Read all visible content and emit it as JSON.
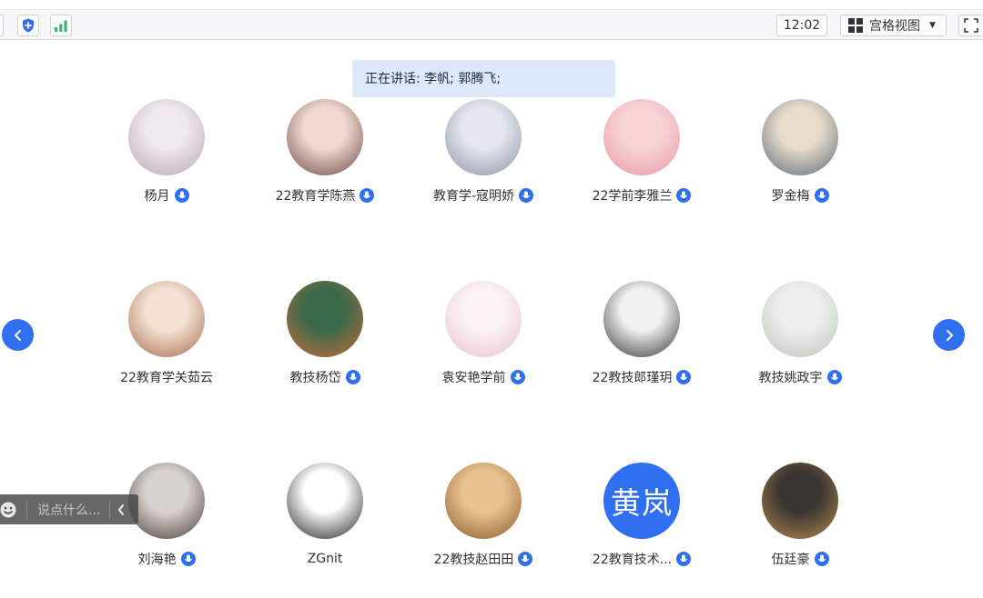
{
  "toolbar": {
    "time": "12:02",
    "view_label": "宫格视图",
    "view_icon": "grid-icon",
    "icons": [
      "shield-plus-icon",
      "signal-bars-icon",
      "fullscreen-icon"
    ]
  },
  "speaking": {
    "text": "正在讲话: 李帆; 郭腾飞;"
  },
  "participants": [
    {
      "name": "杨月",
      "mic": true
    },
    {
      "name": "22教育学陈燕",
      "mic": true
    },
    {
      "name": "教育学-寇明娇",
      "mic": true
    },
    {
      "name": "22学前李雅兰",
      "mic": true
    },
    {
      "name": "罗金梅",
      "mic": true
    },
    {
      "name": "22教育学关茹云",
      "mic": false
    },
    {
      "name": "教技杨岱",
      "mic": true
    },
    {
      "name": "袁安艳学前",
      "mic": true
    },
    {
      "name": "22教技郎瑾玥",
      "mic": true
    },
    {
      "name": "教技姚政宇",
      "mic": true
    },
    {
      "name": "刘海艳",
      "mic": true
    },
    {
      "name": "ZGnit",
      "mic": false
    },
    {
      "name": "22教技赵田田",
      "mic": true
    },
    {
      "name": "22教育技术...",
      "mic": true,
      "avatar_text": "黄岚"
    },
    {
      "name": "伍廷豪",
      "mic": true
    }
  ],
  "nav": {
    "prev_icon": "chevron-left-icon",
    "next_icon": "chevron-right-icon"
  },
  "chat": {
    "placeholder": "说点什么...",
    "emoji_icon": "smiley-icon",
    "collapse_icon": "chevron-left-icon"
  },
  "colors": {
    "accent": "#2f6ff0",
    "speaking_bg": "#dde8fa",
    "toolbar_bg": "#f6f7f9"
  }
}
